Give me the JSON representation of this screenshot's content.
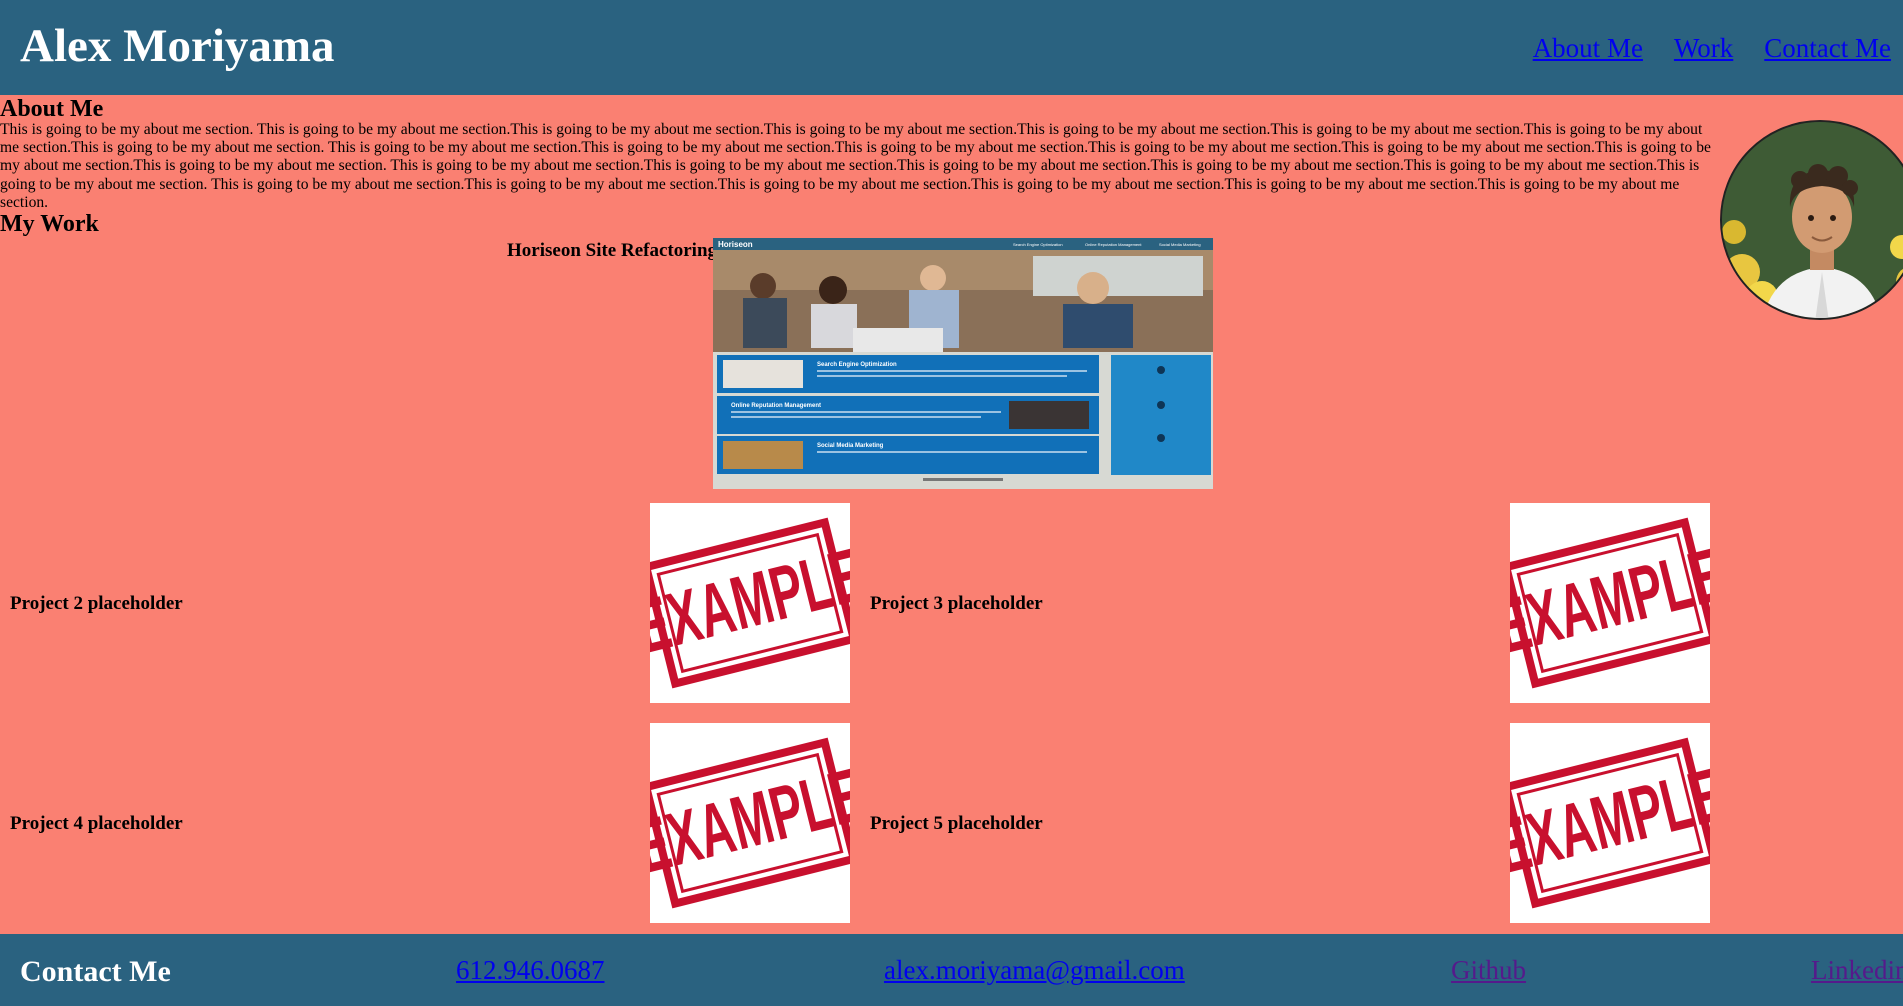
{
  "header": {
    "title": "Alex Moriyama",
    "nav": [
      "About Me",
      "Work",
      "Contact Me"
    ]
  },
  "about": {
    "heading": "About Me",
    "text": "This is going to be my about me section. This is going to be my about me section.This is going to be my about me section.This is going to be my about me section.This is going to be my about me section.This is going to be my about me section.This is going to be my about me section.This is going to be my about me section. This is going to be my about me section.This is going to be my about me section.This is going to be my about me section.This is going to be my about me section.This is going to be my about me section.This is going to be my about me section.This is going to be my about me section. This is going to be my about me section.This is going to be my about me section.This is going to be my about me section.This is going to be my about me section.This is going to be my about me section.This is going to be my about me section. This is going to be my about me section.This is going to be my about me section.This is going to be my about me section.This is going to be my about me section.This is going to be my about me section.This is going to be my about me section."
  },
  "work": {
    "heading": "My Work",
    "featured": {
      "label": "Horiseon Site Refactoring",
      "screenshot": {
        "brand": "Horiseon",
        "nav": [
          "Search Engine Optimization",
          "Online Reputation Management",
          "Social Media Marketing"
        ],
        "sections": [
          "Search Engine Optimization",
          "Online Reputation Management",
          "Social Media Marketing"
        ]
      }
    },
    "projects": [
      {
        "label": "Project 2 placeholder",
        "stamp": "EXAMPLE"
      },
      {
        "label": "Project 3 placeholder",
        "stamp": "EXAMPLE"
      },
      {
        "label": "Project 4 placeholder",
        "stamp": "EXAMPLE"
      },
      {
        "label": "Project 5 placeholder",
        "stamp": "EXAMPLE"
      }
    ]
  },
  "footer": {
    "title": "Contact Me",
    "phone": "612.946.0687",
    "email": "alex.moriyama@gmail.com",
    "github": "Github",
    "linkedin": "Linkedin"
  },
  "colors": {
    "header_bg": "#2a6280",
    "page_bg": "#fa8072",
    "link": "#0000ee",
    "visited_link": "#551a8b",
    "stamp": "#c8102e"
  }
}
